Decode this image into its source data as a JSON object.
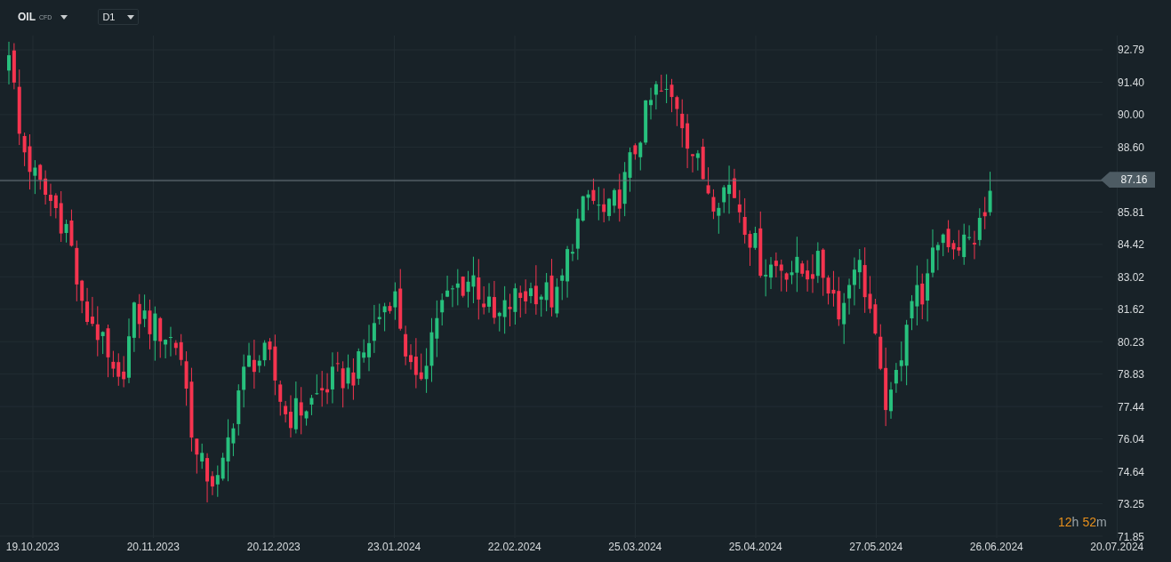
{
  "toolbar": {
    "symbol": "OIL",
    "symbol_type": "CFD",
    "interval": "D1"
  },
  "price_axis_above": [
    "92.79",
    "91.40",
    "90.00",
    "88.60"
  ],
  "current_price": "87.16",
  "price_axis_below": [
    "85.81",
    "84.42",
    "83.02",
    "81.62",
    "80.23",
    "78.83",
    "77.44",
    "76.04",
    "74.64",
    "73.25",
    "71.85"
  ],
  "date_axis": [
    "19.10.2023",
    "20.11.2023",
    "20.12.2023",
    "23.01.2024",
    "22.02.2024",
    "25.03.2024",
    "25.04.2024",
    "27.05.2024",
    "26.06.2024",
    "20.07.2024"
  ],
  "countdown": [
    {
      "text": "12",
      "kind": "number"
    },
    {
      "text": "h",
      "kind": "unit"
    },
    {
      "text": "52",
      "kind": "number"
    },
    {
      "text": "m",
      "kind": "unit"
    }
  ]
}
